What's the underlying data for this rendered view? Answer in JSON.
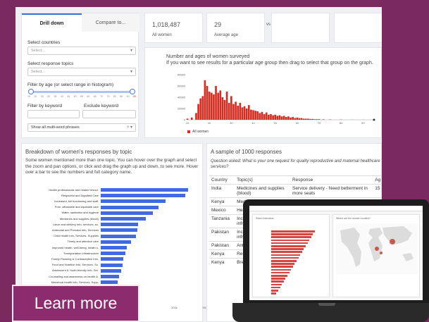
{
  "filters": {
    "tabs": [
      "Drill down",
      "Compare to..."
    ],
    "select_countries_label": "Select countries",
    "select_countries_placeholder": "Select...",
    "select_topics_label": "Select response topics",
    "select_topics_placeholder": "Select...",
    "age_filter_label": "Filter by age (or select range in histogram)",
    "age_ticks": [
      "15",
      "20",
      "25",
      "30",
      "35",
      "40",
      "45",
      "50",
      "55",
      "60",
      "65",
      "70",
      "75",
      "80",
      "85",
      "90",
      "95"
    ],
    "keyword_label": "Filter by keyword",
    "exclude_keyword_label": "Exclude keyword",
    "phrases_select": "Show all multi-word phrases"
  },
  "stats": {
    "total_women": "1,018,487",
    "total_women_label": "All women",
    "average_age": "29",
    "average_age_label": "Average age",
    "vs_label": "vs"
  },
  "histogram": {
    "title": "Number and ages of women surveyed",
    "subtitle": "If you want to see results for a particular age group then drag to select that group on the graph.",
    "legend": "All women",
    "color": "#d62d20",
    "yticks": [
      "80000",
      "60000",
      "40000",
      "20000",
      "0"
    ],
    "xticks": [
      "10",
      "20",
      "30",
      "40",
      "50",
      "60",
      "70",
      "80",
      "90"
    ]
  },
  "chart_data": {
    "type": "bar",
    "title": "Number and ages of women surveyed",
    "ylim": [
      0,
      80000
    ],
    "x": [
      10,
      12,
      14,
      15,
      16,
      17,
      18,
      19,
      20,
      21,
      22,
      23,
      24,
      25,
      26,
      27,
      28,
      29,
      30,
      31,
      32,
      33,
      34,
      35,
      36,
      37,
      38,
      39,
      40,
      41,
      42,
      43,
      44,
      45,
      46,
      47,
      48,
      49,
      50,
      51,
      52,
      53,
      54,
      55,
      56,
      57,
      58,
      59,
      60,
      61,
      62,
      63,
      64,
      65,
      66,
      67,
      68,
      69,
      70,
      72,
      75,
      80,
      85,
      90
    ],
    "values": [
      2000,
      4000,
      12000,
      28000,
      38000,
      42000,
      70000,
      60000,
      50000,
      48000,
      45000,
      60000,
      48000,
      52000,
      40000,
      35000,
      50000,
      30000,
      42000,
      28000,
      32000,
      25000,
      30000,
      22000,
      24000,
      20000,
      26000,
      18000,
      17000,
      16000,
      15000,
      12000,
      14000,
      10000,
      13000,
      9000,
      10000,
      8000,
      9000,
      7000,
      8000,
      6000,
      7000,
      5000,
      6000,
      4000,
      5000,
      3000,
      4000,
      3000,
      3000,
      2000,
      2000,
      2000,
      1500,
      1500,
      1000,
      1000,
      1000,
      800,
      600,
      400,
      200,
      100
    ],
    "legend": "All women"
  },
  "breakdown": {
    "title": "Breakdown of women's responses by topic",
    "description": "Some women mentioned more than one topic. You can hover over the graph and select the zoom and pan options, or click and drag the graph up and down, to see more. Hover over a bar to see the numbers and full category name.",
    "bars": [
      {
        "label": "Health professionals and related resour.",
        "value": 1.0
      },
      {
        "label": "Respectful and Dignified Care",
        "value": 0.97
      },
      {
        "label": "Increased, full functioning and staff.",
        "value": 0.74
      },
      {
        "label": "Free, affordable and equitable care",
        "value": 0.66
      },
      {
        "label": "Water, sanitation and hygiene",
        "value": 0.6
      },
      {
        "label": "Medicines and supplies (blood)",
        "value": 0.52
      },
      {
        "label": "Labor and delivery info, services, su.",
        "value": 0.43
      },
      {
        "label": "Antenatal and Prenatal Info, Services",
        "value": 0.42
      },
      {
        "label": "Child health info, Services, Supplies",
        "value": 0.4
      },
      {
        "label": "Timely and attentive care",
        "value": 0.35
      },
      {
        "label": "Improved health, well-being, health s.",
        "value": 0.3
      },
      {
        "label": "Transportation infrastructure",
        "value": 0.28
      },
      {
        "label": "Family Planning & Contraceptive Info,",
        "value": 0.26
      },
      {
        "label": "Food and Nutrition info, Services, Su.",
        "value": 0.25
      },
      {
        "label": "Adolescent & Youth-friendly Info, Ser.",
        "value": 0.23
      },
      {
        "label": "Counseling and awareness on health &.",
        "value": 0.21
      },
      {
        "label": "Menstrual health info, Services, Supp.",
        "value": 0.19
      }
    ],
    "xticks": [
      "100k",
      "150k"
    ]
  },
  "sample": {
    "title": "A sample of 1000 responses",
    "question": "Question asked: What is your one request for quality reproductive and maternal healthcare services?",
    "columns": [
      "Country",
      "Topic(s)",
      "Response",
      "Ag"
    ],
    "rows": [
      [
        "India",
        "Medicines and supplies (blood)",
        "Service delivery - Need betterment in more seats",
        "15"
      ],
      [
        "Kenya",
        "Medicines and",
        "",
        ""
      ],
      [
        "Mexico",
        "Health pro",
        "",
        ""
      ],
      [
        "Tanzania",
        "Increased, health fac infrastruc",
        "",
        ""
      ],
      [
        "Pakistan",
        "Increased, health fac infrastruc",
        "",
        ""
      ],
      [
        "Pakistan",
        "Antenatal a Supplies",
        "",
        ""
      ],
      [
        "Kenya",
        "Respectful",
        "",
        ""
      ],
      [
        "Kenya",
        "Breast, Ce Services, S",
        "",
        ""
      ]
    ]
  },
  "laptop": {
    "panel_left_title": "Select indicators",
    "panel_right_title": "Where are the women located?"
  },
  "cta": {
    "label": "Learn more"
  }
}
